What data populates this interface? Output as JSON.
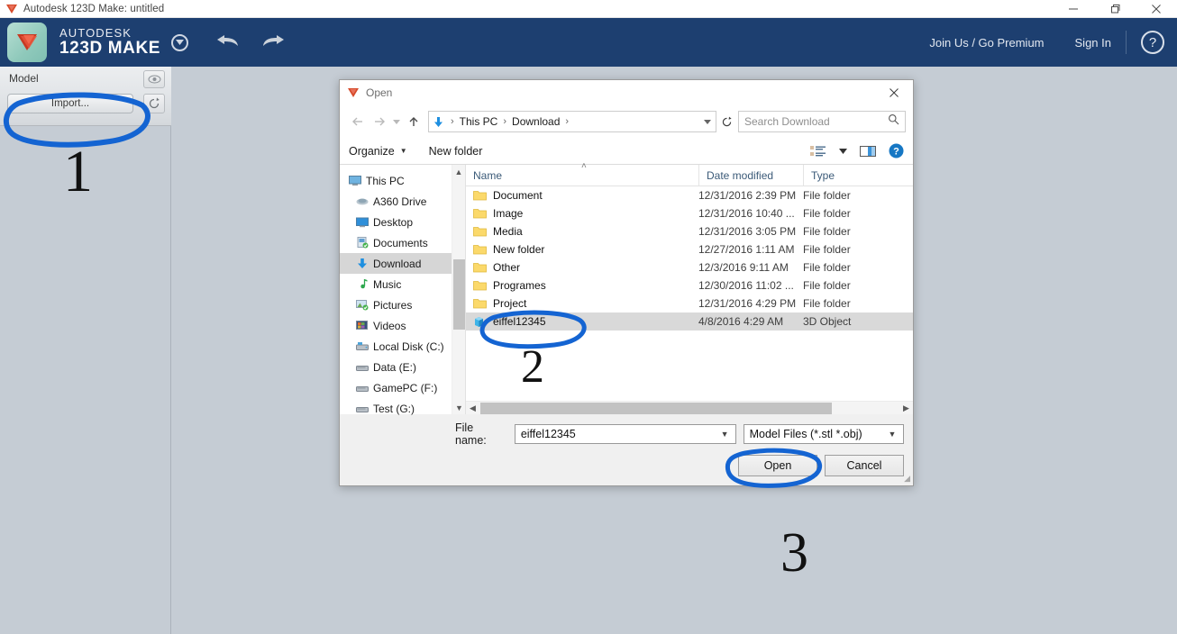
{
  "window": {
    "title": "Autodesk 123D Make: untitled",
    "icon": "app-logo-icon",
    "minimize": "minimize-icon",
    "maximize": "maximize-icon",
    "close": "close-icon"
  },
  "header": {
    "brand_top": "AUTODESK",
    "brand_bottom": "123D  MAKE",
    "caret": "chevron-down-icon",
    "undo": "undo-icon",
    "redo": "redo-icon",
    "join_link": "Join Us / Go Premium",
    "signin_link": "Sign In",
    "help": "?",
    "bg_color": "#1d3f70"
  },
  "sidebar": {
    "panel_title": "Model",
    "import_label": "Import...",
    "eye_icon": "eye-icon",
    "refresh_icon": "refresh-icon"
  },
  "canvas": {
    "bg_color": "#c5ccd4"
  },
  "dialog": {
    "title": "Open",
    "close": "close-icon",
    "nav": {
      "back": "back-arrow-icon",
      "forward": "forward-arrow-icon",
      "recent": "chevron-down-icon",
      "up": "up-arrow-icon",
      "refresh": "refresh-icon",
      "crumb_icon": "download-icon",
      "crumbs": [
        "This PC",
        "Download"
      ],
      "crumb_trailing": "›",
      "crumb_caret": "˅"
    },
    "search": {
      "placeholder": "Search Download",
      "value": "",
      "icon": "search-icon"
    },
    "toolbar": {
      "organize": "Organize",
      "new_folder": "New folder",
      "view_icon": "view-layout-icon",
      "preview_icon": "preview-pane-icon",
      "help_icon": "help-icon"
    },
    "tree": {
      "items": [
        {
          "label": "This PC",
          "icon": "monitor-icon",
          "level": 0,
          "selected": false
        },
        {
          "label": "A360 Drive",
          "icon": "cloud-icon",
          "level": 1,
          "selected": false
        },
        {
          "label": "Desktop",
          "icon": "desktop-icon",
          "level": 1,
          "selected": false
        },
        {
          "label": "Documents",
          "icon": "documents-icon",
          "level": 1,
          "selected": false
        },
        {
          "label": "Download",
          "icon": "download-icon",
          "level": 1,
          "selected": true
        },
        {
          "label": "Music",
          "icon": "music-icon",
          "level": 1,
          "selected": false
        },
        {
          "label": "Pictures",
          "icon": "pictures-icon",
          "level": 1,
          "selected": false
        },
        {
          "label": "Videos",
          "icon": "videos-icon",
          "level": 1,
          "selected": false
        },
        {
          "label": "Local Disk (C:)",
          "icon": "drive-icon",
          "level": 1,
          "selected": false
        },
        {
          "label": "Data (E:)",
          "icon": "drive-icon",
          "level": 1,
          "selected": false
        },
        {
          "label": "GamePC (F:)",
          "icon": "drive-icon",
          "level": 1,
          "selected": false
        },
        {
          "label": "Test (G:)",
          "icon": "drive-icon",
          "level": 1,
          "selected": false
        }
      ]
    },
    "filelist": {
      "columns": [
        "Name",
        "Date modified",
        "Type"
      ],
      "sort_indicator": "˄",
      "rows": [
        {
          "name": "Document",
          "date": "12/31/2016 2:39 PM",
          "type": "File folder",
          "icon": "folder-icon",
          "selected": false
        },
        {
          "name": "Image",
          "date": "12/31/2016 10:40 ...",
          "type": "File folder",
          "icon": "folder-icon",
          "selected": false
        },
        {
          "name": "Media",
          "date": "12/31/2016 3:05 PM",
          "type": "File folder",
          "icon": "folder-icon",
          "selected": false
        },
        {
          "name": "New folder",
          "date": "12/27/2016 1:11 AM",
          "type": "File folder",
          "icon": "folder-icon",
          "selected": false
        },
        {
          "name": "Other",
          "date": "12/3/2016 9:11 AM",
          "type": "File folder",
          "icon": "folder-icon",
          "selected": false
        },
        {
          "name": "Programes",
          "date": "12/30/2016 11:02 ...",
          "type": "File folder",
          "icon": "folder-icon",
          "selected": false
        },
        {
          "name": "Project",
          "date": "12/31/2016 4:29 PM",
          "type": "File folder",
          "icon": "folder-icon",
          "selected": false
        },
        {
          "name": "eiffel12345",
          "date": "4/8/2016 4:29 AM",
          "type": "3D Object",
          "icon": "3d-object-icon",
          "selected": true
        }
      ]
    },
    "footer": {
      "filename_label": "File name:",
      "filename_value": "eiffel12345",
      "filetype_value": "Model Files (*.stl *.obj)",
      "open_label": "Open",
      "cancel_label": "Cancel"
    }
  },
  "annotations": {
    "ink_color": "#1464d2",
    "steps": [
      {
        "number": "1",
        "target": "import-button"
      },
      {
        "number": "2",
        "target": "file-row-eiffel12345"
      },
      {
        "number": "3",
        "target": "open-button"
      }
    ]
  }
}
